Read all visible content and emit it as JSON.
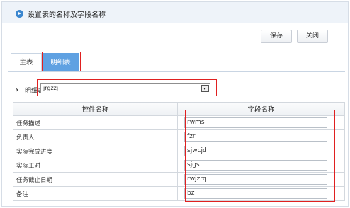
{
  "header": {
    "title": "设置表的名称及字段名称",
    "icon": "play-circle-icon"
  },
  "toolbar": {
    "save_label": "保存",
    "close_label": "关闭"
  },
  "tabs": [
    {
      "label": "主表",
      "active": false
    },
    {
      "label": "明细表",
      "active": true
    }
  ],
  "detail_table": {
    "label": "明细表",
    "selected_value": "jrgzzj"
  },
  "grid": {
    "headers": [
      "控件名称",
      "字段名称"
    ],
    "rows": [
      {
        "control": "任务描述",
        "field": "rwms"
      },
      {
        "control": "负责人",
        "field": "fzr"
      },
      {
        "control": "实际完成进度",
        "field": "sjwcjd"
      },
      {
        "control": "实际工时",
        "field": "sjgs"
      },
      {
        "control": "任务截止日期",
        "field": "rwjzrq"
      },
      {
        "control": "备注",
        "field": "bz"
      }
    ]
  },
  "colors": {
    "accent": "#5fa1e2",
    "header_bg": "#eef3f9",
    "highlight_outline": "#e02020"
  }
}
